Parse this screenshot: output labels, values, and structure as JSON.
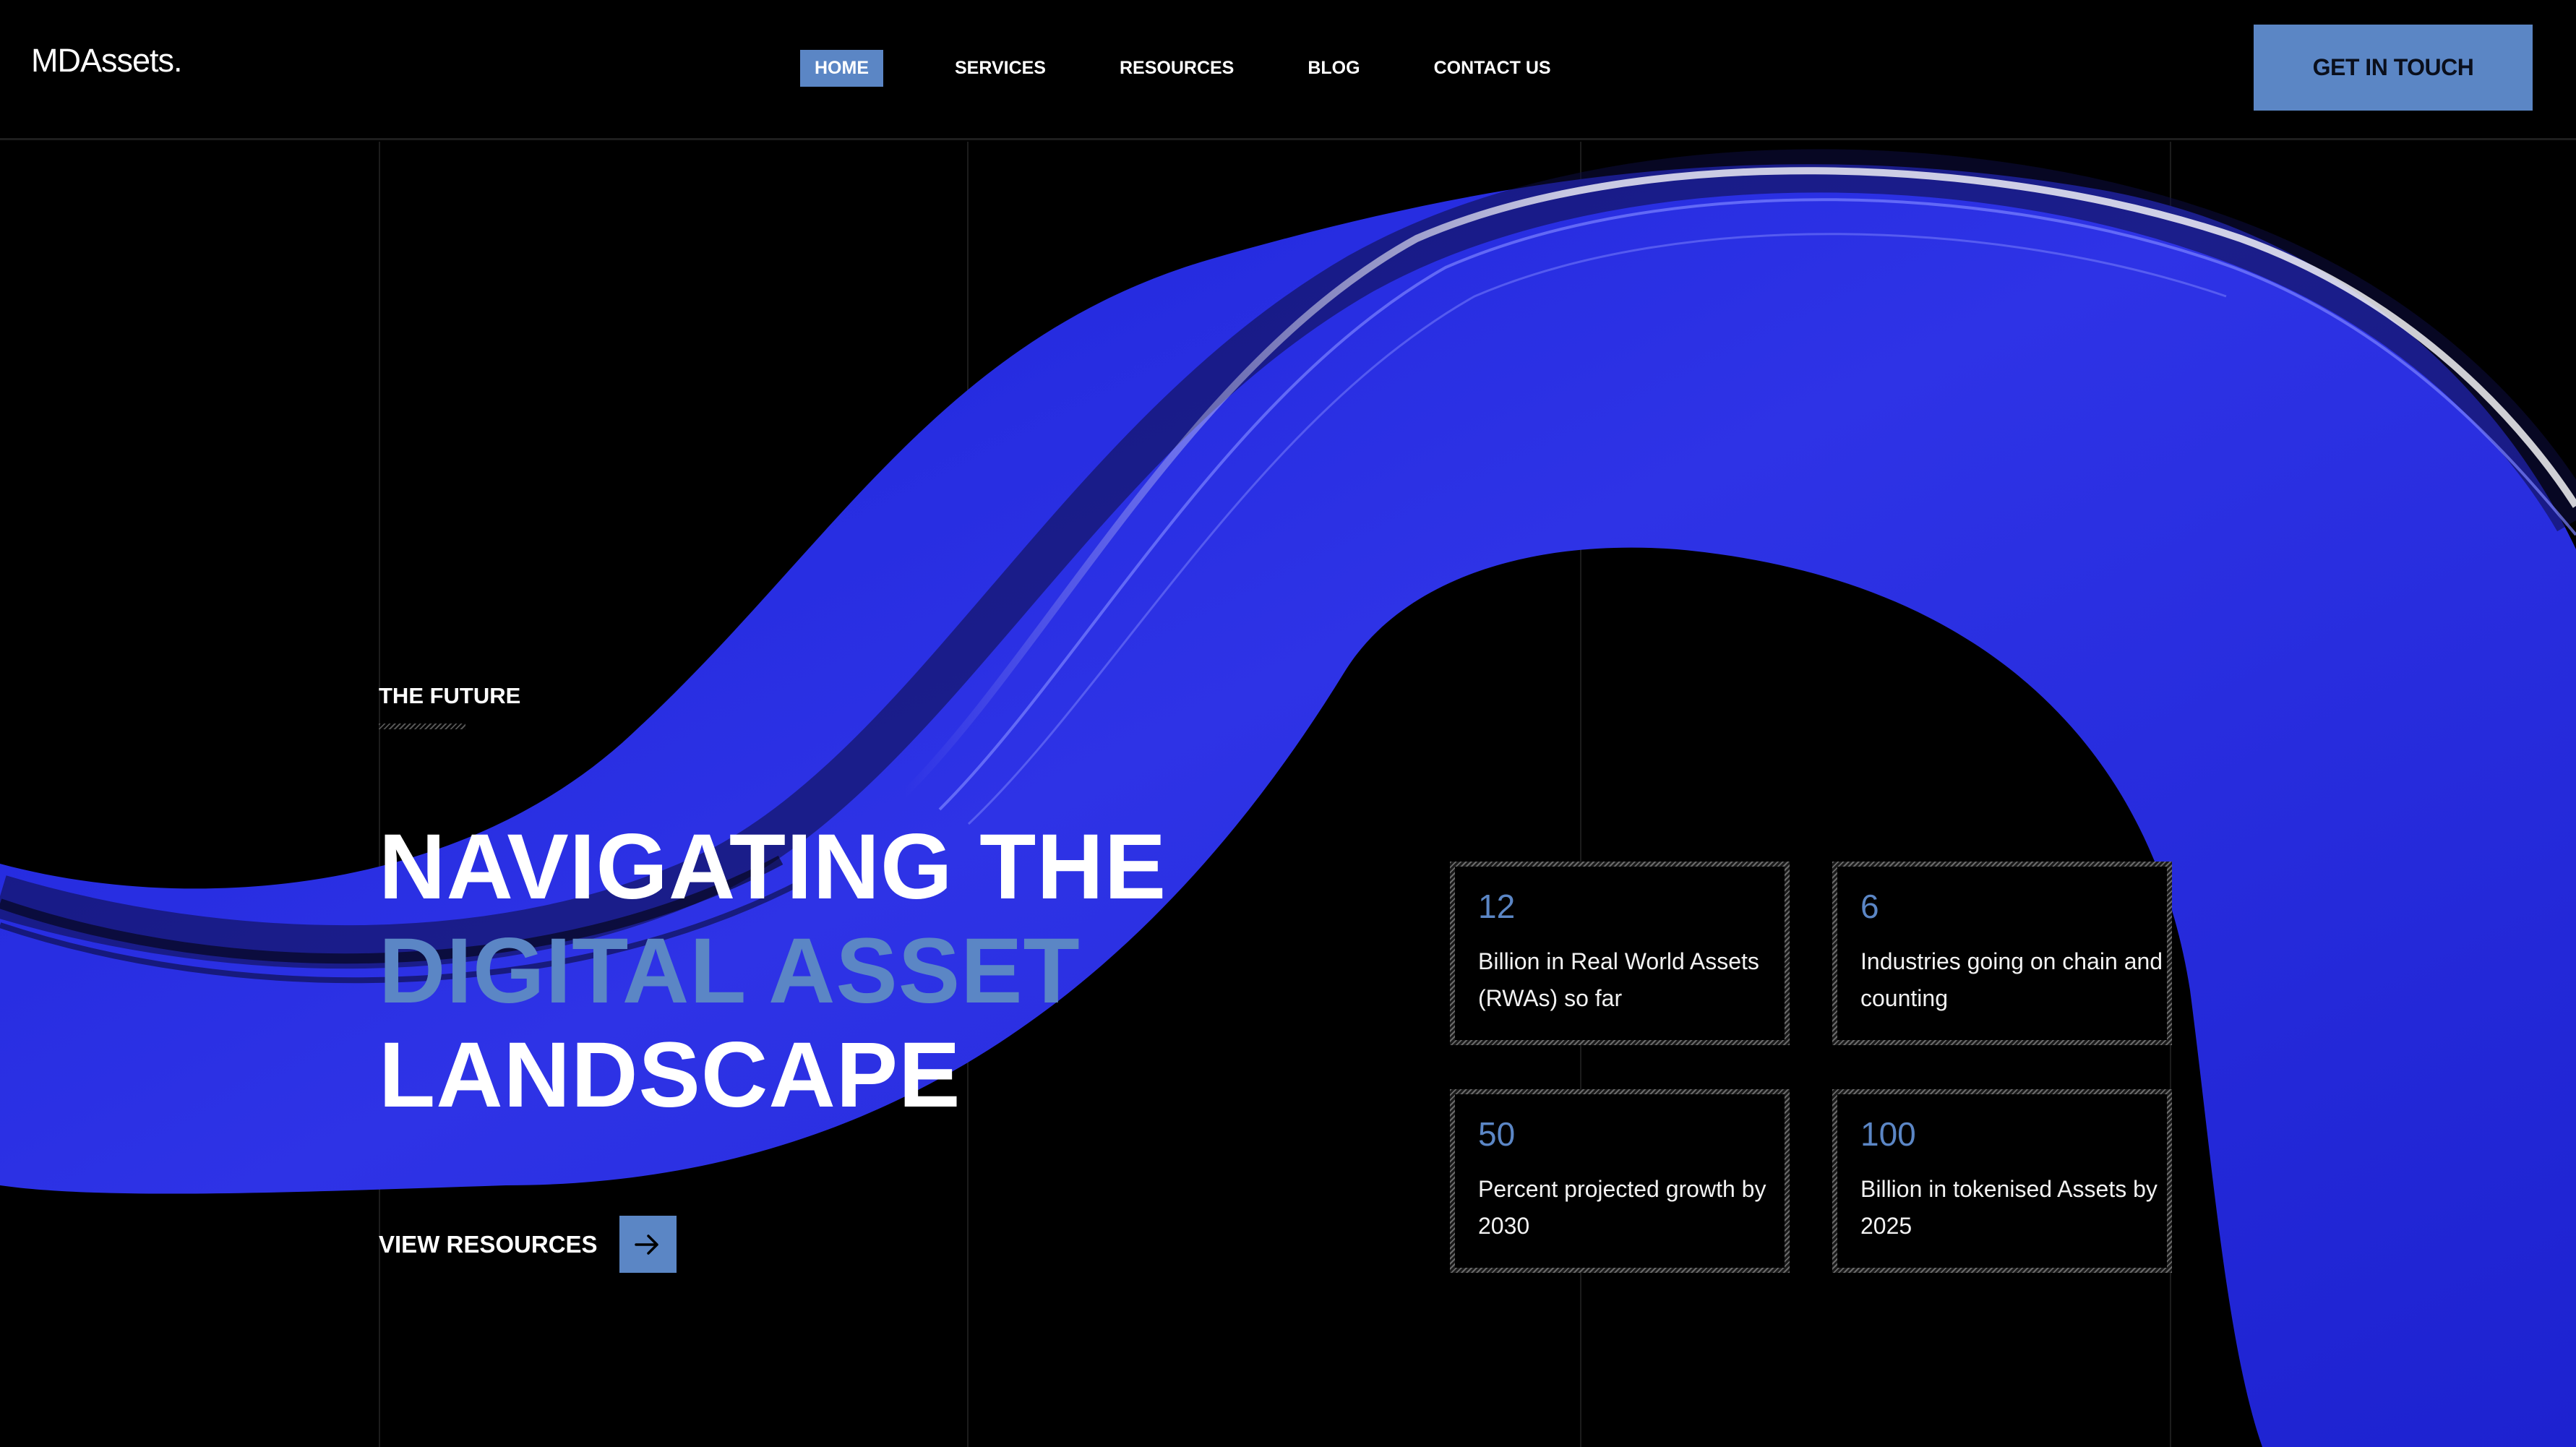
{
  "brand": {
    "logo": "MDAssets.",
    "accent_color": "#5b86c5",
    "ribbon_color": "#2a2ee0",
    "background": "#000000"
  },
  "nav": {
    "items": [
      {
        "label": "HOME",
        "active": true
      },
      {
        "label": "SERVICES",
        "active": false
      },
      {
        "label": "RESOURCES",
        "active": false
      },
      {
        "label": "BLOG",
        "active": false
      },
      {
        "label": "CONTACT US",
        "active": false
      }
    ],
    "cta_label": "GET IN TOUCH"
  },
  "hero": {
    "eyebrow": "THE FUTURE",
    "headline_line1": "NAVIGATING THE",
    "headline_line2": "DIGITAL ASSET",
    "headline_line3": "LANDSCAPE",
    "link_label": "VIEW RESOURCES",
    "link_icon": "arrow-right-icon"
  },
  "stats": [
    {
      "value": "12",
      "label": "Billion in Real World Assets (RWAs) so far"
    },
    {
      "value": "6",
      "label": "Industries going on chain and counting"
    },
    {
      "value": "50",
      "label": "Percent projected growth by 2030"
    },
    {
      "value": "100",
      "label": "Billion in tokenised Assets by 2025"
    }
  ]
}
